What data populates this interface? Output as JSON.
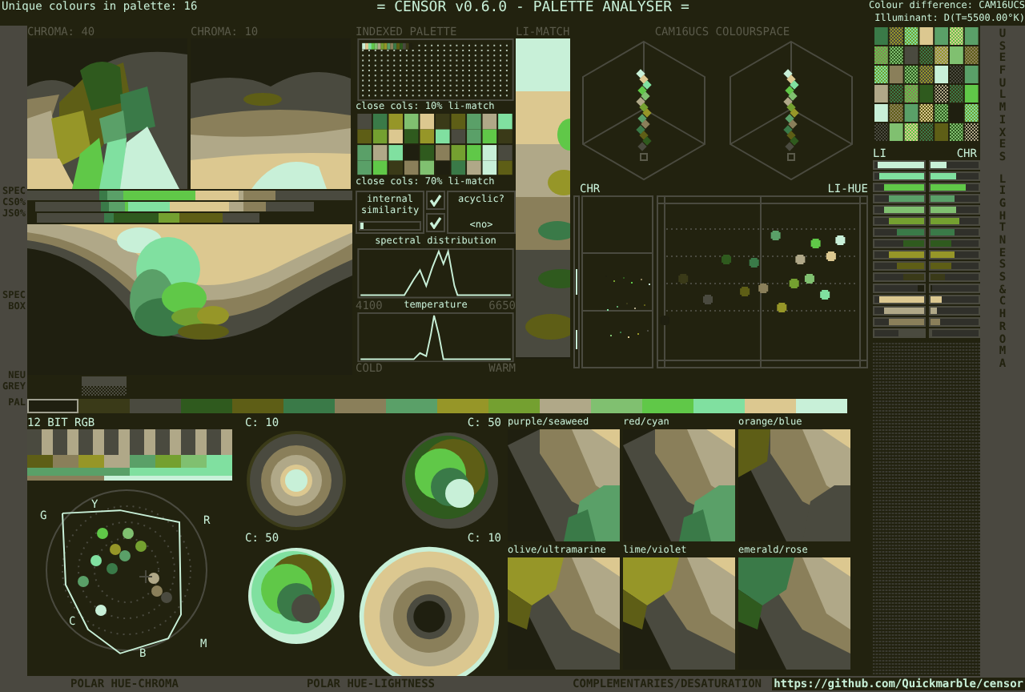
{
  "header": {
    "unique_colours": "Unique colours in palette: 16",
    "title": "= CENSOR v0.6.0 - PALETTE ANALYSER =",
    "colour_difference": "Colour difference: CAM16UCS",
    "illuminant": "Illuminant: D(T=5500.00°K)"
  },
  "side_labels": {
    "spec": "SPEC",
    "cs": "CS0%",
    "js": "JS0%",
    "spec_box": "SPEC BOX",
    "neu_grey": "NEU GREY",
    "pal": "PAL"
  },
  "chroma_views": [
    {
      "label": "CHROMA: 40"
    },
    {
      "label": "CHROMA: 10"
    }
  ],
  "indexed_palette": {
    "title": "INDEXED PALETTE"
  },
  "close_cols": [
    "close cols: 10% li-match",
    "close cols: 70% li-match"
  ],
  "internal_similarity": {
    "label": "internal similarity",
    "checked": true,
    "level": 0.05
  },
  "acyclic": {
    "label": "acyclic?",
    "checked": true,
    "value": "<no>"
  },
  "spectral": {
    "title": "spectral distribution",
    "min": "4100",
    "max": "6650"
  },
  "temperature": {
    "title": "temperature",
    "min": "COLD",
    "max": "WARM"
  },
  "li_match": {
    "title": "LI-MATCH"
  },
  "colourspace": {
    "title": "CAM16UCS COLOURSPACE",
    "chr": "CHR",
    "li_hue": "LI-HUE"
  },
  "useful_mixes": {
    "title": "USEFUL MIXES"
  },
  "lightness_chroma": {
    "title": "LIGHTNESS & CHROMA",
    "li": "LI",
    "chr": "CHR",
    "rows": [
      {
        "color": "#c8f0d8",
        "lightness": {
          "level": 0.95
        },
        "chroma": {
          "level": 0.35
        }
      },
      {
        "color": "#80e0a0",
        "lightness": {
          "level": 0.9
        },
        "chroma": {
          "level": 0.55
        }
      },
      {
        "color": "#60c848",
        "lightness": {
          "level": 0.82
        },
        "chroma": {
          "level": 0.75
        }
      },
      {
        "color": "#5aa068",
        "lightness": {
          "level": 0.7
        },
        "chroma": {
          "level": 0.5
        }
      },
      {
        "color": "#80c070",
        "lightness": {
          "level": 0.82
        },
        "chroma": {
          "level": 0.55
        }
      },
      {
        "color": "#74a030",
        "lightness": {
          "level": 0.72
        },
        "chroma": {
          "level": 0.6
        }
      },
      {
        "color": "#3a7a48",
        "lightness": {
          "level": 0.55
        },
        "chroma": {
          "level": 0.5
        }
      },
      {
        "color": "#2f5a1e",
        "lightness": {
          "level": 0.42
        },
        "chroma": {
          "level": 0.45
        }
      },
      {
        "color": "#969628",
        "lightness": {
          "level": 0.7
        },
        "chroma": {
          "level": 0.5
        }
      },
      {
        "color": "#5e5e16",
        "lightness": {
          "level": 0.55
        },
        "chroma": {
          "level": 0.45
        }
      },
      {
        "color": "#3a3a18",
        "lightness": {
          "level": 0.4
        },
        "chroma": {
          "level": 0.3
        }
      },
      {
        "color": "#1f1f10",
        "lightness": {
          "level": 0.1
        },
        "chroma": {
          "level": 0.05
        }
      },
      {
        "color": "#dcc890",
        "lightness": {
          "level": 0.9
        },
        "chroma": {
          "level": 0.25
        }
      },
      {
        "color": "#b0a888",
        "lightness": {
          "level": 0.82
        },
        "chroma": {
          "level": 0.15
        }
      },
      {
        "color": "#8a7f5a",
        "lightness": {
          "level": 0.7
        },
        "chroma": {
          "level": 0.2
        }
      },
      {
        "color": "#4a4a3f",
        "lightness": {
          "level": 0.5
        },
        "chroma": {
          "level": 0.05
        }
      }
    ]
  },
  "palette": [
    {
      "color": "#1f1f10",
      "selected": true
    },
    {
      "color": "#3a3a18",
      "selected": false
    },
    {
      "color": "#4a4a3f",
      "selected": false
    },
    {
      "color": "#2f5a1e",
      "selected": false
    },
    {
      "color": "#5e5e16",
      "selected": false
    },
    {
      "color": "#3a7a48",
      "selected": false
    },
    {
      "color": "#8a7f5a",
      "selected": false
    },
    {
      "color": "#5aa068",
      "selected": false
    },
    {
      "color": "#969628",
      "selected": false
    },
    {
      "color": "#74a030",
      "selected": false
    },
    {
      "color": "#b0a888",
      "selected": false
    },
    {
      "color": "#80c070",
      "selected": false
    },
    {
      "color": "#60c848",
      "selected": false
    },
    {
      "color": "#80e0a0",
      "selected": false
    },
    {
      "color": "#dcc890",
      "selected": false
    },
    {
      "color": "#c8f0d8",
      "selected": false
    }
  ],
  "rgb12": {
    "title": "12 BIT RGB"
  },
  "polar_chroma": {
    "title": "POLAR HUE-CHROMA",
    "hues": [
      "G",
      "Y",
      "R",
      "C",
      "M",
      "B"
    ]
  },
  "polar_lightness": {
    "title": "POLAR HUE-LIGHTNESS",
    "rings": [
      "C: 10",
      "C: 50",
      "C: 50",
      "C: 10"
    ]
  },
  "complementaries": {
    "title": "COMPLEMENTARIES/DESATURATION",
    "pairs": [
      "purple/seaweed",
      "red/cyan",
      "orange/blue",
      "olive/ultramarine",
      "lime/violet",
      "emerald/rose"
    ]
  },
  "url": "https://github.com/Quickmarble/censor"
}
